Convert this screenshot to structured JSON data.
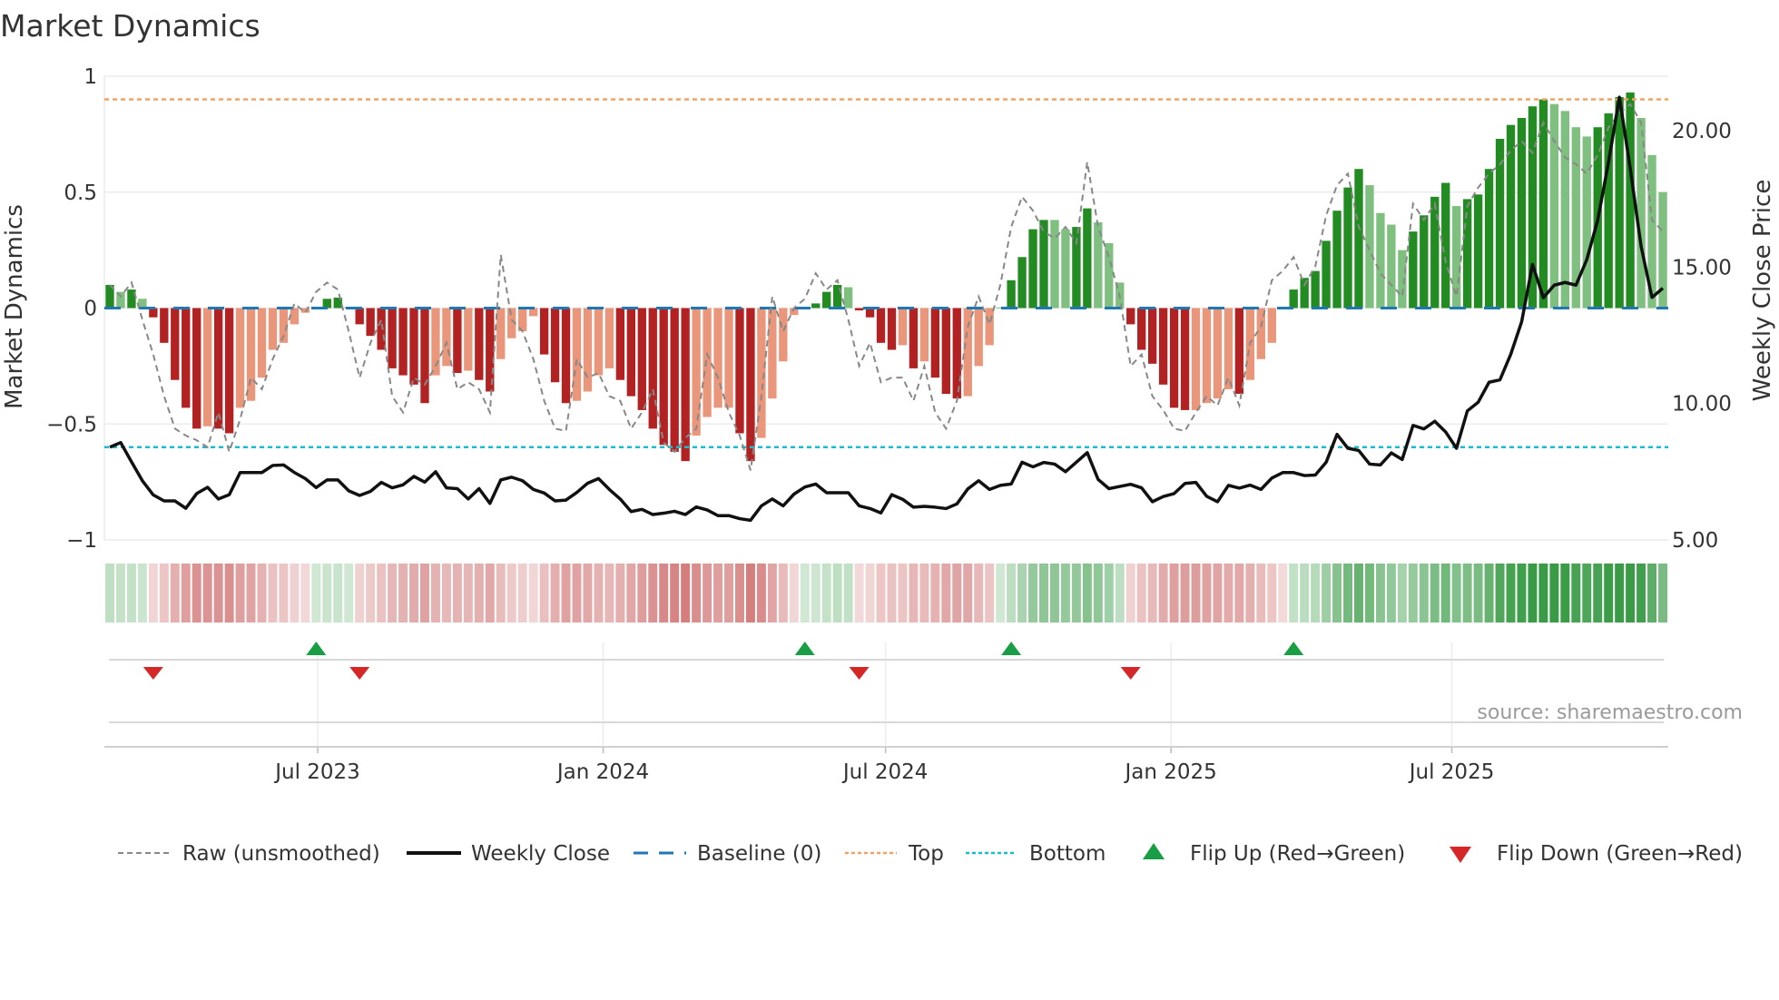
{
  "chart_data": {
    "type": "bar",
    "title": "Market Dynamics",
    "ylabel": "Market Dynamics",
    "y2label": "Weekly Close Price",
    "ylim": [
      -1,
      1
    ],
    "y2lim": [
      5,
      22
    ],
    "start_date": "2023-02-17",
    "frequency": "weekly",
    "yticks": [
      {
        "v": 1,
        "label": "1"
      },
      {
        "v": 0.5,
        "label": "0.5"
      },
      {
        "v": 0,
        "label": "0"
      },
      {
        "v": -0.5,
        "label": "−0.5"
      },
      {
        "v": -1,
        "label": "−1"
      }
    ],
    "y2ticks": [
      {
        "v": 5,
        "label": "5.00"
      },
      {
        "v": 10,
        "label": "10.00"
      },
      {
        "v": 15,
        "label": "15.00"
      },
      {
        "v": 20,
        "label": "20.00"
      }
    ],
    "xticks": [
      {
        "date": "2023-07-01",
        "label": "Jul 2023"
      },
      {
        "date": "2024-01-01",
        "label": "Jan 2024"
      },
      {
        "date": "2024-07-01",
        "label": "Jul 2024"
      },
      {
        "date": "2025-01-01",
        "label": "Jan 2025"
      },
      {
        "date": "2025-07-01",
        "label": "Jul 2025"
      }
    ],
    "top_level": 0.9,
    "bottom_level": -0.6,
    "baseline": 0,
    "values": [
      0.1,
      0.07,
      0.08,
      0.04,
      -0.04,
      -0.15,
      -0.31,
      -0.43,
      -0.52,
      -0.51,
      -0.52,
      -0.54,
      -0.43,
      -0.4,
      -0.3,
      -0.18,
      -0.15,
      -0.07,
      -0.02,
      0.005,
      0.04,
      0.045,
      0.005,
      -0.07,
      -0.12,
      -0.18,
      -0.26,
      -0.29,
      -0.33,
      -0.41,
      -0.29,
      -0.25,
      -0.28,
      -0.27,
      -0.31,
      -0.36,
      -0.22,
      -0.13,
      -0.1,
      -0.035,
      -0.2,
      -0.32,
      -0.41,
      -0.4,
      -0.36,
      -0.29,
      -0.26,
      -0.31,
      -0.38,
      -0.44,
      -0.52,
      -0.59,
      -0.62,
      -0.66,
      -0.55,
      -0.47,
      -0.43,
      -0.43,
      -0.54,
      -0.66,
      -0.56,
      -0.39,
      -0.23,
      -0.03,
      0.003,
      0.02,
      0.07,
      0.1,
      0.09,
      -0.01,
      -0.04,
      -0.15,
      -0.18,
      -0.16,
      -0.26,
      -0.23,
      -0.3,
      -0.37,
      -0.39,
      -0.38,
      -0.25,
      -0.16,
      0.003,
      0.12,
      0.22,
      0.34,
      0.38,
      0.38,
      0.34,
      0.35,
      0.43,
      0.37,
      0.28,
      0.11,
      -0.07,
      -0.18,
      -0.24,
      -0.33,
      -0.43,
      -0.44,
      -0.44,
      -0.41,
      -0.39,
      -0.35,
      -0.37,
      -0.31,
      -0.22,
      -0.15,
      -0.005,
      0.08,
      0.13,
      0.16,
      0.29,
      0.42,
      0.52,
      0.6,
      0.53,
      0.41,
      0.36,
      0.25,
      0.33,
      0.4,
      0.48,
      0.54,
      0.44,
      0.47,
      0.49,
      0.6,
      0.73,
      0.79,
      0.82,
      0.87,
      0.9,
      0.88,
      0.85,
      0.78,
      0.74,
      0.78,
      0.84,
      0.91,
      0.93,
      0.82,
      0.66,
      0.5
    ],
    "bar_shade": "GgGgRRRRRrRRrrrrrrrgGGgRRRRRRRrrRrRRrrrrRRRrrrrRRRRRRRrrrrRRrrrrgGGGgRRRRrRrRRRrrrgGGGGggGGgggRRRRRRrrrrRrrrrGGGGGGGggggGGGGgGGGGGGGGggggGGGGggg",
    "raw": [
      0.1,
      0.05,
      0.11,
      -0.05,
      -0.2,
      -0.38,
      -0.52,
      -0.55,
      -0.57,
      -0.6,
      -0.45,
      -0.62,
      -0.48,
      -0.3,
      -0.35,
      -0.22,
      -0.12,
      0.02,
      -0.02,
      0.07,
      0.11,
      0.08,
      -0.1,
      -0.3,
      -0.15,
      -0.05,
      -0.38,
      -0.45,
      -0.3,
      -0.33,
      -0.25,
      -0.15,
      -0.35,
      -0.32,
      -0.35,
      -0.45,
      0.23,
      -0.05,
      -0.1,
      -0.22,
      -0.4,
      -0.52,
      -0.53,
      -0.22,
      -0.3,
      -0.28,
      -0.38,
      -0.4,
      -0.52,
      -0.45,
      -0.35,
      -0.58,
      -0.62,
      -0.56,
      -0.52,
      -0.2,
      -0.3,
      -0.45,
      -0.55,
      -0.7,
      -0.38,
      0.05,
      -0.1,
      0.0,
      0.04,
      0.15,
      0.08,
      0.12,
      -0.05,
      -0.25,
      -0.15,
      -0.32,
      -0.3,
      -0.3,
      -0.4,
      -0.25,
      -0.45,
      -0.52,
      -0.4,
      -0.08,
      0.05,
      -0.07,
      0.1,
      0.35,
      0.48,
      0.42,
      0.33,
      0.3,
      0.35,
      0.28,
      0.63,
      0.35,
      0.22,
      0.05,
      -0.25,
      -0.2,
      -0.38,
      -0.44,
      -0.52,
      -0.53,
      -0.45,
      -0.38,
      -0.42,
      -0.3,
      -0.42,
      -0.15,
      -0.08,
      0.12,
      0.16,
      0.22,
      0.1,
      0.18,
      0.4,
      0.53,
      0.58,
      0.35,
      0.25,
      0.15,
      0.1,
      0.05,
      0.45,
      0.38,
      0.45,
      0.2,
      0.05,
      0.44,
      0.52,
      0.58,
      0.62,
      0.68,
      0.72,
      0.67,
      0.8,
      0.72,
      0.65,
      0.62,
      0.58,
      0.66,
      0.78,
      0.84,
      0.88,
      0.8,
      0.38,
      0.33
    ],
    "close": [
      8.4,
      8.57,
      7.86,
      7.17,
      6.65,
      6.43,
      6.43,
      6.16,
      6.7,
      6.93,
      6.5,
      6.66,
      7.47,
      7.47,
      7.47,
      7.73,
      7.75,
      7.47,
      7.25,
      6.92,
      7.2,
      7.2,
      6.8,
      6.63,
      6.78,
      7.11,
      6.91,
      7.02,
      7.33,
      7.12,
      7.5,
      6.91,
      6.88,
      6.5,
      6.88,
      6.34,
      7.2,
      7.3,
      7.17,
      6.85,
      6.72,
      6.43,
      6.46,
      6.74,
      7.08,
      7.25,
      6.85,
      6.5,
      6.04,
      6.12,
      5.93,
      5.98,
      6.05,
      5.93,
      6.21,
      6.1,
      5.89,
      5.89,
      5.78,
      5.72,
      6.25,
      6.5,
      6.25,
      6.68,
      6.94,
      7.05,
      6.73,
      6.73,
      6.73,
      6.25,
      6.15,
      5.99,
      6.66,
      6.49,
      6.2,
      6.23,
      6.2,
      6.15,
      6.32,
      6.87,
      7.17,
      6.85,
      7.0,
      7.05,
      7.85,
      7.68,
      7.84,
      7.78,
      7.5,
      7.85,
      8.2,
      7.22,
      6.88,
      6.96,
      7.04,
      6.91,
      6.4,
      6.59,
      6.7,
      7.07,
      7.11,
      6.6,
      6.4,
      7.0,
      6.9,
      7.01,
      6.85,
      7.27,
      7.47,
      7.47,
      7.36,
      7.38,
      7.85,
      8.87,
      8.36,
      8.28,
      7.78,
      7.75,
      8.19,
      7.95,
      9.2,
      9.07,
      9.35,
      8.96,
      8.36,
      9.73,
      10.05,
      10.78,
      10.87,
      11.81,
      13.0,
      15.1,
      13.88,
      14.34,
      14.44,
      14.34,
      15.28,
      16.72,
      18.85,
      21.23,
      18.62,
      15.76,
      13.89,
      14.23
    ],
    "flip_up_index": [
      19,
      64,
      83,
      109
    ],
    "flip_down_index": [
      4,
      23,
      69,
      94
    ],
    "legend": {
      "raw": "Raw (unsmoothed)",
      "close": "Weekly Close",
      "baseline": "Baseline (0)",
      "top": "Top",
      "bottom": "Bottom",
      "flip_up": "Flip Up (Red→Green)",
      "flip_down": "Flip Down (Green→Red)"
    },
    "source": "source: sharemaestro.com",
    "colors": {
      "strong_up": "#228b22",
      "weak_up": "#7fbf7f",
      "strong_down": "#b22222",
      "weak_down": "#e9967a",
      "baseline": "#1f77b4",
      "top": "#f4a261",
      "bottom": "#17becf",
      "close": "#111111",
      "raw": "#888888",
      "flip_up": "#1a9e45",
      "flip_down": "#d62728"
    }
  }
}
